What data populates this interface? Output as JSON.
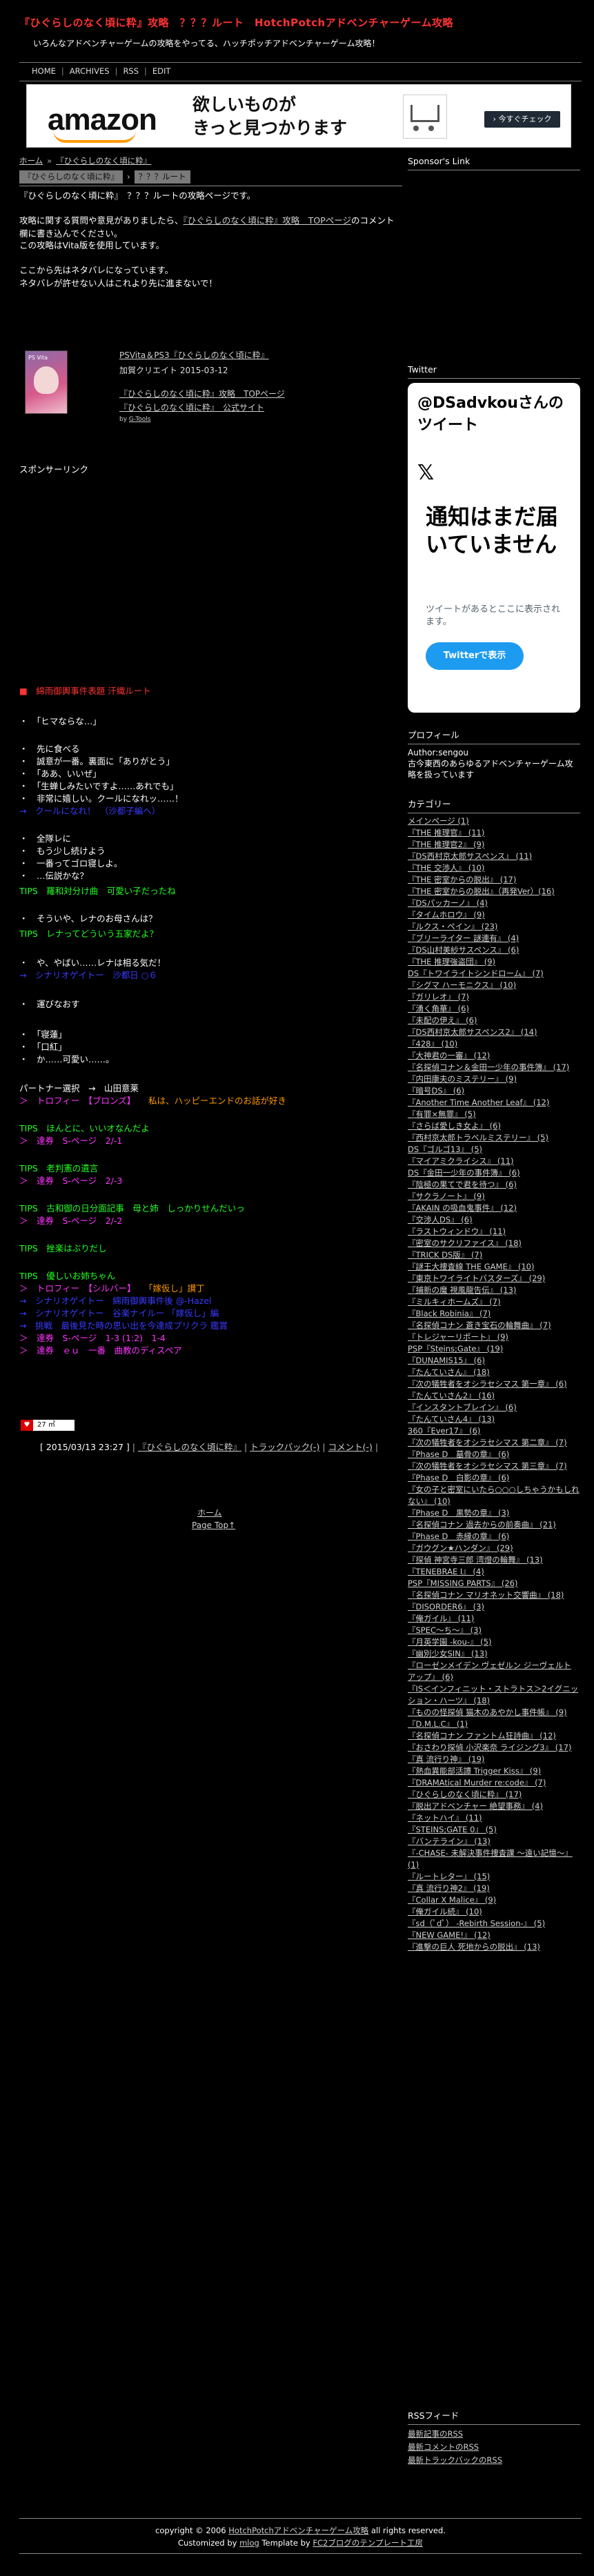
{
  "header": {
    "title": "『ひぐらしのなく頃に粋』攻略　？？？ルート　HotchPotchアドベンチャーゲーム攻略",
    "description": "いろんなアドベンチャーゲームの攻略をやってる、ハッチポッチアドベンチャーゲーム攻略！"
  },
  "nav": {
    "items": [
      "HOME",
      "ARCHIVES",
      "RSS",
      "EDIT"
    ]
  },
  "ad": {
    "brand": "amazon",
    "line1": "欲しいものが",
    "line2": "きっと見つかります",
    "cta": "› 今すぐチェック"
  },
  "breadcrumb": {
    "home": "ホーム",
    "category": "『ひぐらしのなく頃に粋』"
  },
  "entry": {
    "title_category": "『ひぐらしのなく頃に粋』",
    "title_page": "？？？ルート",
    "intro": "『ひぐらしのなく頃に粋』　？？？ルートの攻略ページです。",
    "question_pre": "攻略に関する質問や意見がありましたら、",
    "question_link": "『ひぐらしのなく頃に粋』攻略　TOPページ",
    "question_post": "のコメント欄に書き込んでください。",
    "version": "この攻略はVita版を使用しています。",
    "spoiler1": "ここから先はネタバレになっています。",
    "spoiler2": "ネタバレが許せない人はこれより先に進まないで！"
  },
  "product": {
    "platform_label": "PS Vita",
    "title": "PSVita＆PS3『ひぐらしのなく頃に粋』",
    "date": "加賀クリエイト 2015-03-12",
    "link1": "『ひぐらしのなく頃に粋』攻略　TOPページ",
    "link2": "『ひぐらしのなく頃に粋』　公式サイト",
    "by_prefix": "by ",
    "by_name": "G-Tools"
  },
  "sponsor_label": "スポンサーリンク",
  "walkthrough": {
    "chapter": "■　綿雨御輿事件表題 汗織ルート",
    "s1": "・　「ヒマならな…」",
    "s2a": "・　先に食べる",
    "s2b": "・　誠意が一番。裏面に「ありがとう」",
    "s2c": "・　「ああ、いいぜ」",
    "s2d": "・　「生蝉しみたいですよ……あれでも」",
    "s2e": "・　非常に嬉しい。クールになれッ……！",
    "s2f": "→　クールになれ！　（沙都子編へ）",
    "s3a": "・　全隊レに",
    "s3b": "・　もう少し続けよう",
    "s3c": "・　一番ってゴロ寝しよ。",
    "s3d": "・　…伝説かな？",
    "tips1": "TIPS　羅和対分け曲　可愛い子だったね",
    "s4": "・　そういや、レナのお母さんは？",
    "tips2": "TIPS　レナってどういう五家だよ？",
    "s5a": "・　や、やばい……レナは相る気だ！",
    "s5b": "→　シナリオゲイトー　沙都日 ○６",
    "s6a": "・　運びなおす",
    "s7a": "・　「寝蓮」",
    "s7b": "・　「口紅」",
    "s7c": "・　か……可愛い……。",
    "partner": "パートナー選択　→　山田意莱",
    "trophy1_a": "＞　トロフィー　【ブロンズ】",
    "trophy1_b": "私は、ハッピーエンドのお話が好き",
    "tips3": "TIPS　ほんとに、いいオなんだよ",
    "tips3b": "＞　達券　S-ページ　2/-1",
    "tips4": "TIPS　老判憲の遺言",
    "tips4b": "＞　達券　S-ページ　2/-3",
    "tips5": "TIPS　古和御の日分面記事　母と姉　しっかりせんだいっ",
    "tips5b": "＞　達券　S-ページ　2/-2",
    "tips6": "TIPS　挫楽はぶりだし",
    "tips7": "TIPS　優しいお姉ちゃん",
    "trophy2_a": "＞　トロフィー　【シルバー】",
    "trophy2_b": "「嫁仮し」讃丁",
    "r1": "→　シナリオゲイトー　綿雨御輿事件後 @-Hazel",
    "r2": "→　シナリオゲイトー　谷楽ナイルー 「嫁仮し」編",
    "r3": "→　挑戦　最後見た時の思い出を今達成プリクラ 鑑賞",
    "r4": "＞　達券　S-ページ　1-3 (1:2)　1-4",
    "r5": "＞　達券　ｅｕ　一番　曲教のディスペア"
  },
  "counter": {
    "icon": "♥",
    "value": "27 ㎡"
  },
  "meta": {
    "date": "[ 2015/03/13 23:27 ]",
    "category": "『ひぐらしのなく頃に粋』",
    "trackback": "トラックバック(-)",
    "comment": "コメント(-)"
  },
  "bottom_nav": {
    "home": "ホーム",
    "top": "Page Top↑"
  },
  "sidebar": {
    "sponsor_heading": "Sponsor's Link",
    "twitter_heading": "Twitter",
    "twitter_widget": {
      "title": "@DSadvkouさんのツイート",
      "message": "通知はまだ届いていません",
      "sub": "ツイートがあるとここに表示されます。",
      "button": "Twitterで表示"
    },
    "profile_heading": "プロフィール",
    "profile_author": "Author:sengou",
    "profile_text": "古今東西のあらゆるアドベンチャーゲーム攻略を扱っています",
    "category_heading": "カテゴリー",
    "categories": [
      "メインページ (1)",
      "『THE 推理官』 (11)",
      "『THE 推理官2』 (9)",
      "『DS西村京太郎サスペンス』 (11)",
      "『THE 交渉人』 (10)",
      "『THE 密室からの脱出』 (17)",
      "『THE 密室からの脱出』（再発Ver）(16)",
      "『DSパッカーノ』 (4)",
      "『タイムホロウ』 (9)",
      "『ルクス・ペイン』 (23)",
      "『ブリーライター 謎連有』 (4)",
      "『DS山村美紗サスペンス』 (6)",
      "『THE 推理強盗団』 (9)",
      "DS『トワイライトシンドローム』 (7)",
      "『シグマ ハーモニクス』 (10)",
      "『ガリレオ』 (7)",
      "『湧く角華』 (6)",
      "『未配の伊え』 (6)",
      "『DS西村京太郎サスペンス2』 (14)",
      "『428』 (10)",
      "『大神君の一審』 (12)",
      "『名探偵コナン＆金田一少年の事件簿』 (17)",
      "『内田康夫のミステリー』 (9)",
      "『暗号DS』 (6)",
      "『Another Time Another Leaf』 (12)",
      "『有罪×無罪』 (5)",
      "『さらば愛しき女よ』 (6)",
      "『西村京太郎トラベルミステリー』 (5)",
      "DS『ゴルゴ13』 (5)",
      "『マイアミクライシス』 (11)",
      "DS『金田一少年の事件簿』 (6)",
      "『陰極の果てで君を待つ』 (6)",
      "『サクラノート』 (9)",
      "『AKAIN の吸血鬼事件』 (12)",
      "『交渉人DS』 (6)",
      "『ラストウィンドウ』 (11)",
      "『密室のサクリファイス』 (18)",
      "『TRICK DS版』 (7)",
      "『謎王大捜査線 THE GAME』 (10)",
      "『東京トワイライトバスターズ』 (29)",
      "『捕新の魔 視風龍告伝』 (13)",
      "『ミルキィホームズ』 (7)",
      "『Black Robinia』 (7)",
      "『名探偵コナン 蒼き宝石の輪舞曲』 (7)",
      "『トレジャーリポート』 (9)",
      "PSP『Steins;Gate』 (19)",
      "『DUNAMIS15』 (6)",
      "『たんていさん』 (18)",
      "『次の犠牲者をオシラセシマス 第一章』 (6)",
      "『たんていさん2』 (16)",
      "『インスタントブレイン』 (6)",
      "『たんていさん4』 (13)",
      "360『Ever17』 (6)",
      "『次の犠牲者をオシラセシマス 第二章』 (7)",
      "『Phase D　墓骨の章』 (6)",
      "『次の犠牲者をオシラセシマス 第三章』 (7)",
      "『Phase D　白影の章』 (6)",
      "『女の子と密室にいたら○○○しちゃうかもしれない』 (10)",
      "『Phase D　黒勢の章』 (3)",
      "『名探偵コナン 過去からの前奏曲』 (21)",
      "『Phase D　赤縁の章』 (6)",
      "『ガウグン★ハンダン』 (29)",
      "『探偵 神宮寺三郎 湾燈の輪舞』 (13)",
      "『TENEBRAE I』 (4)",
      "PSP『MISSING PARTS』 (26)",
      "『名探偵コナン マリオネット交響曲』 (18)",
      "『DISORDER6』 (3)",
      "『俺ガイル』 (11)",
      "『SPEC～ち～』 (3)",
      "『月英学園 -kou-』 (5)",
      "『幽別少女SIN』 (13)",
      "『ローゼンメイデン ヴェゼルン ジーヴェルト アップ』 (6)",
      "『IS＜インフィニット・ストラトス＞2イグニッション・ハーツ』 (18)",
      "『ものの怪探偵 猫木のあやかし事件帳』 (9)",
      "『D.M.L.C』 (1)",
      "『名探偵コナン ファントム狂詩曲』 (12)",
      "『おさわり探偵 小沢楽奈 ライジング3』 (17)",
      "『真 流行り神』 (19)",
      "『熱血異能部活譚 Trigger Kiss』 (9)",
      "『DRAMAtical Murder re:code』 (7)",
      "『ひぐらしのなく頃に粋』 (17)",
      "『脱出アドベンチャー 絶望事務』 (4)",
      "『ネットハイ』 (11)",
      "『STEINS;GATE 0』 (5)",
      "『バンテライン』 (13)",
      "『-CHASE- 未解決事件捜査課 ～遠い記憶～』 (1)",
      "『ルートレター』 (15)",
      "『真 流行り神2』 (19)",
      "『Collar X Malice』 (9)",
      "『俺ガイル続』 (10)",
      "『sd（ﾟdﾟ） -Rebirth Session-』 (5)",
      "『NEW GAME!』 (12)",
      "『進撃の巨人 死地からの脱出』 (13)"
    ],
    "rss_heading": "RSSフィード",
    "rss_items": [
      "最新記事のRSS",
      "最新コメントのRSS",
      "最新トラックバックのRSS"
    ]
  },
  "footer": {
    "line1_pre": "copyright © 2006 ",
    "line1_link": "HotchPotchアドベンチャーゲーム攻略",
    "line1_post": " all rights reserved.",
    "line2_pre": "Customized by ",
    "line2_link1": "mlog",
    "line2_mid": " Template by ",
    "line2_link2": "FC2ブログのテンプレート工房"
  }
}
